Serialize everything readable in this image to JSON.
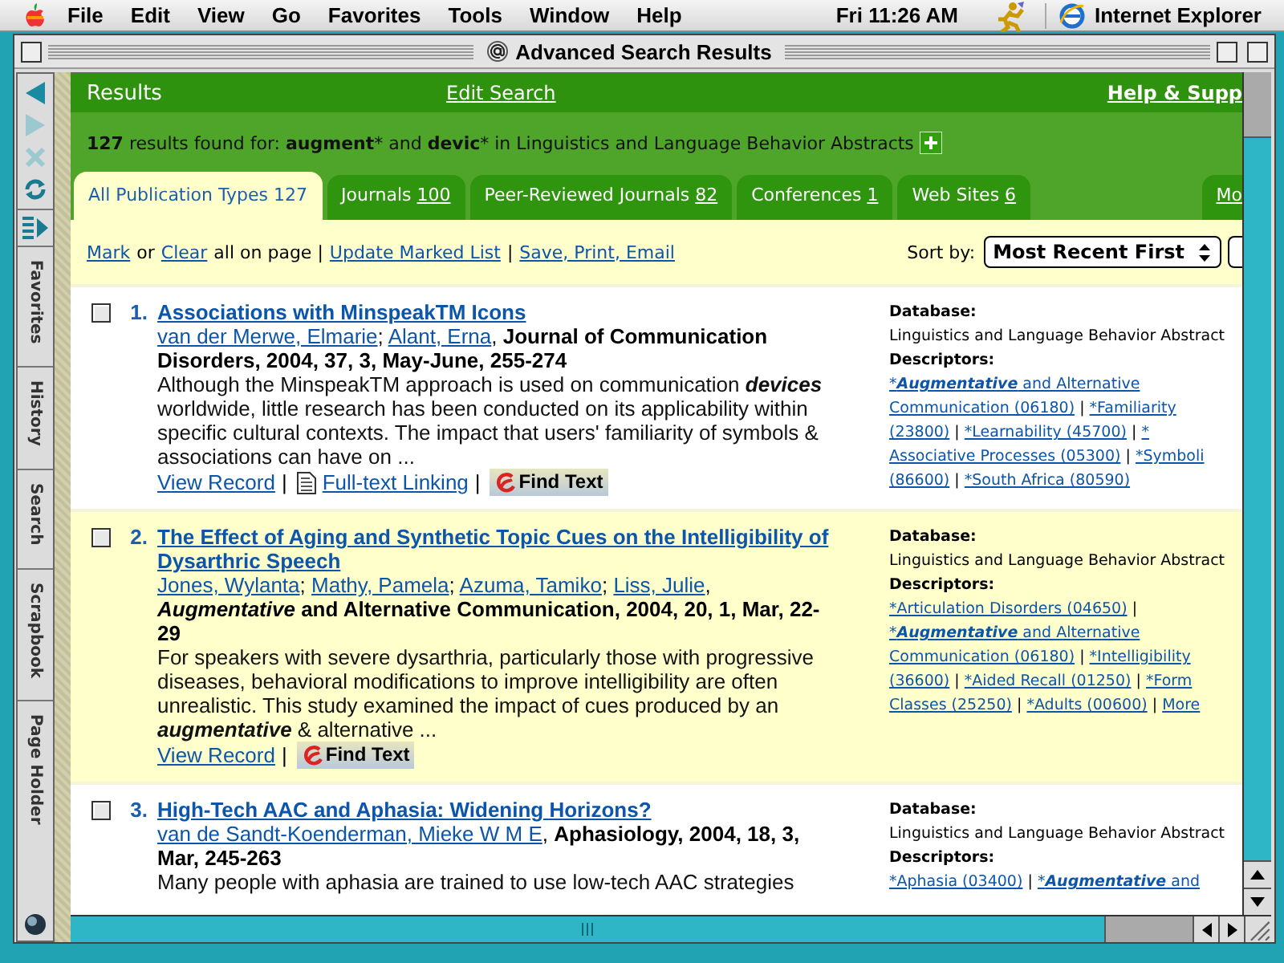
{
  "menu_bar": {
    "items": [
      "File",
      "Edit",
      "View",
      "Go",
      "Favorites",
      "Tools",
      "Window",
      "Help"
    ],
    "clock": "Fri 11:26 AM",
    "app": "Internet Explorer"
  },
  "window": {
    "title": "Advanced Search Results"
  },
  "explorer_bar": {
    "tabs": [
      "Favorites",
      "History",
      "Search",
      "Scrapbook",
      "Page Holder"
    ]
  },
  "header": {
    "title": "Results",
    "edit_link": "Edit Search",
    "help_link": "Help & Supp"
  },
  "summary": [
    {
      "text": "127",
      "bold": true
    },
    {
      "text": " results found for: ",
      "bold": false
    },
    {
      "text": "augment",
      "bold": true
    },
    {
      "text": "* and ",
      "bold": false
    },
    {
      "text": "devic",
      "bold": true
    },
    {
      "text": "* in Linguistics and Language Behavior Abstracts",
      "bold": false
    }
  ],
  "tabs": [
    {
      "label": "All Publication Types",
      "count": "127",
      "selected": true
    },
    {
      "label": "Journals",
      "count": "100",
      "selected": false
    },
    {
      "label": "Peer-Reviewed Journals",
      "count": "82",
      "selected": false
    },
    {
      "label": "Conferences",
      "count": "1",
      "selected": false
    },
    {
      "label": "Web Sites",
      "count": "6",
      "selected": false
    },
    {
      "label": "Mo",
      "kind": "more",
      "selected": false
    }
  ],
  "toolbar": {
    "items": [
      {
        "kind": "link",
        "text": "Mark"
      },
      {
        "kind": "text",
        "text": "or"
      },
      {
        "kind": "link",
        "text": "Clear"
      },
      {
        "kind": "text",
        "text": "all on page |"
      },
      {
        "kind": "link",
        "text": "Update Marked List"
      },
      {
        "kind": "text",
        "text": "|"
      },
      {
        "kind": "link",
        "text": "Save, Print, Email"
      }
    ],
    "sort_label": "Sort by:",
    "sort_value": "Most Recent First"
  },
  "results": [
    {
      "number": "1.",
      "checked": false,
      "title": "Associations with MinspeakTM Icons",
      "authors": [
        {
          "name": "van der Merwe, Elmarie",
          "sep": ";"
        },
        {
          "name": "Alant, Erna",
          "sep": ","
        }
      ],
      "source": "Journal of Communication Disorders, 2004, 37, 3, May-June, 255-274",
      "abstract": "Although the MinspeakTM approach is used on communication **devices** worldwide, little research has been conducted on its applicability within specific cultural contexts. The impact that users' familiarity of symbols & associations can have on ...",
      "actions": [
        {
          "kind": "link",
          "label": "View Record",
          "sep": "|"
        },
        {
          "kind": "fulltext",
          "label": "Full-text Linking",
          "sep": "|"
        },
        {
          "kind": "findtext",
          "label": "Find Text"
        }
      ],
      "database_label": "Database:",
      "database": "Linguistics and Language Behavior Abstract",
      "descriptors_label": "Descriptors:",
      "descriptors": [
        {
          "parts": [
            {
              "before": "*",
              "match": "Augmentative",
              "after": " and Alternative"
            },
            {
              "text": "Communication (06180)"
            }
          ],
          "sep": "|"
        },
        {
          "parts": [
            {
              "text": "*Familiarity"
            },
            {
              "text": "(23800)"
            }
          ],
          "sep": "|"
        },
        {
          "parts": [
            {
              "text": "*Learnability (45700)"
            }
          ],
          "sep": "|"
        },
        {
          "parts": [
            {
              "text": "*"
            },
            {
              "text": "Associative Processes (05300)"
            }
          ],
          "sep": "|"
        },
        {
          "parts": [
            {
              "text": "*Symboli"
            },
            {
              "text": "(86600)"
            }
          ],
          "sep": "|"
        },
        {
          "parts": [
            {
              "text": "*South Africa (80590)"
            }
          ]
        }
      ]
    },
    {
      "number": "2.",
      "checked": false,
      "title": "The Effect of Aging and Synthetic Topic Cues on the Intelligibility of Dysarthric Speech",
      "authors": [
        {
          "name": "Jones, Wylanta",
          "sep": ";"
        },
        {
          "name": "Mathy, Pamela",
          "sep": ";"
        },
        {
          "name": "Azuma, Tamiko",
          "sep": ";"
        },
        {
          "name": "Liss, Julie",
          "sep": ","
        }
      ],
      "source": "*Augmentative* and Alternative Communication, 2004, 20, 1, Mar, 22-29",
      "abstract": "For speakers with severe dysarthria, particularly those with progressive diseases, behavioral modifications to improve intelligibility are often unrealistic. This study examined the impact of cues produced by an **augmentative** & alternative ...",
      "actions": [
        {
          "kind": "link",
          "label": "View Record",
          "sep": "|"
        },
        {
          "kind": "findtext",
          "label": "Find Text"
        }
      ],
      "database_label": "Database:",
      "database": "Linguistics and Language Behavior Abstract",
      "descriptors_label": "Descriptors:",
      "descriptors": [
        {
          "parts": [
            {
              "text": "*Articulation Disorders (04650)"
            }
          ],
          "sep": "|"
        },
        {
          "parts": [
            {
              "before": "*",
              "match": "Augmentative",
              "after": " and Alternative"
            },
            {
              "text": "Communication (06180)"
            }
          ],
          "sep": "|"
        },
        {
          "parts": [
            {
              "text": "*Intelligibility"
            },
            {
              "text": "(36600)"
            }
          ],
          "sep": "|"
        },
        {
          "parts": [
            {
              "text": "*Aided Recall (01250)"
            }
          ],
          "sep": "|"
        },
        {
          "parts": [
            {
              "text": "*Form"
            },
            {
              "text": "Classes (25250)"
            }
          ],
          "sep": "|"
        },
        {
          "parts": [
            {
              "text": "*Adults (00600)"
            }
          ],
          "sep": "|"
        },
        {
          "parts": [
            {
              "text": "More"
            }
          ]
        }
      ]
    },
    {
      "number": "3.",
      "checked": false,
      "title": "High-Tech AAC and Aphasia: Widening Horizons?",
      "authors": [
        {
          "name": "van de Sandt-Koenderman, Mieke W M E",
          "sep": ","
        }
      ],
      "source": "Aphasiology, 2004, 18, 3, Mar, 245-263",
      "abstract": "Many people with aphasia are trained to use low-tech AAC strategies",
      "database_label": "Database:",
      "database": "Linguistics and Language Behavior Abstract",
      "descriptors_label": "Descriptors:",
      "descriptors": [
        {
          "parts": [
            {
              "text": "*Aphasia (03400)"
            }
          ],
          "sep": "|"
        },
        {
          "parts": [
            {
              "before": "*",
              "match": "Augmentative",
              "after": " and"
            }
          ]
        }
      ]
    }
  ]
}
